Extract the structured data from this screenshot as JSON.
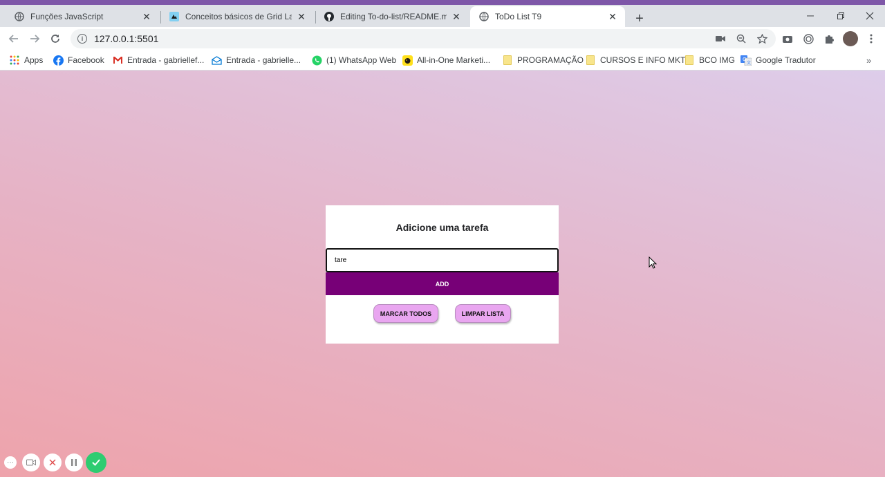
{
  "browser": {
    "tabs": [
      {
        "title": "Funções JavaScript",
        "icon": "globe-icon"
      },
      {
        "title": "Conceitos básicos de Grid Layout",
        "icon": "mdn-icon"
      },
      {
        "title": "Editing To-do-list/README.md at",
        "icon": "github-icon"
      },
      {
        "title": "ToDo List T9",
        "icon": "globe-icon"
      }
    ],
    "url": "127.0.0.1:5501",
    "bookmarks": [
      {
        "label": "Apps",
        "icon": "apps-grid-icon"
      },
      {
        "label": "Facebook",
        "icon": "facebook-icon"
      },
      {
        "label": "Entrada - gabriellef...",
        "icon": "gmail-icon"
      },
      {
        "label": "Entrada - gabrielle...",
        "icon": "mail-icon"
      },
      {
        "label": "(1) WhatsApp Web",
        "icon": "whatsapp-icon"
      },
      {
        "label": "All-in-One Marketi...",
        "icon": "mailchimp-icon"
      },
      {
        "label": "PROGRAMAÇÃO",
        "icon": "folder-icon"
      },
      {
        "label": "CURSOS E INFO MKT",
        "icon": "folder-icon"
      },
      {
        "label": "BCO IMG",
        "icon": "folder-icon"
      },
      {
        "label": "Google Tradutor",
        "icon": "translate-icon"
      }
    ],
    "overflow": "»"
  },
  "todo": {
    "heading": "Adicione uma tarefa",
    "input_value": "tare",
    "add_label": "ADD",
    "mark_all_label": "MARCAR TODOS",
    "clear_label": "LIMPAR LISTA",
    "accent_color": "#770077",
    "pill_color": "#e9a6f0"
  }
}
